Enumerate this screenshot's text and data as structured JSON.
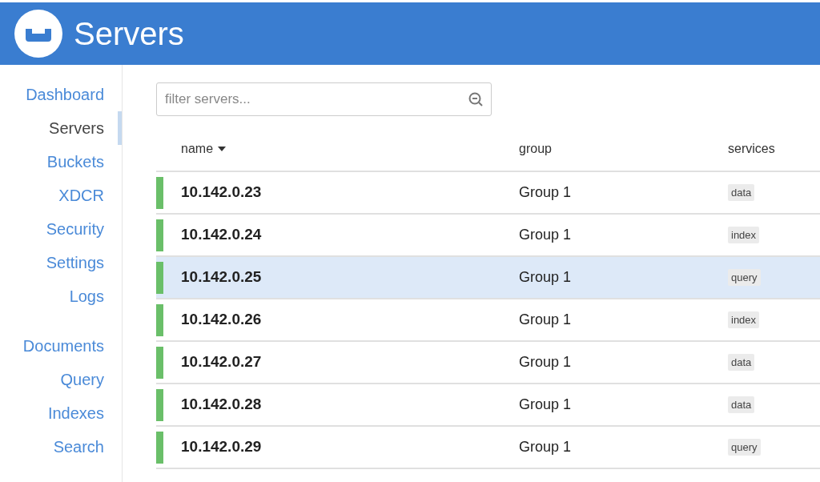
{
  "header": {
    "title": "Servers"
  },
  "sidebar": {
    "groups": [
      [
        {
          "label": "Dashboard",
          "selected": false
        },
        {
          "label": "Servers",
          "selected": true
        },
        {
          "label": "Buckets",
          "selected": false
        },
        {
          "label": "XDCR",
          "selected": false
        },
        {
          "label": "Security",
          "selected": false
        },
        {
          "label": "Settings",
          "selected": false
        },
        {
          "label": "Logs",
          "selected": false
        }
      ],
      [
        {
          "label": "Documents",
          "selected": false
        },
        {
          "label": "Query",
          "selected": false
        },
        {
          "label": "Indexes",
          "selected": false
        },
        {
          "label": "Search",
          "selected": false
        }
      ]
    ]
  },
  "filter": {
    "placeholder": "filter servers..."
  },
  "table": {
    "columns": [
      "name",
      "group",
      "services"
    ],
    "rows": [
      {
        "name": "10.142.0.23",
        "group": "Group 1",
        "service": "data",
        "selected": false
      },
      {
        "name": "10.142.0.24",
        "group": "Group 1",
        "service": "index",
        "selected": false
      },
      {
        "name": "10.142.0.25",
        "group": "Group 1",
        "service": "query",
        "selected": true
      },
      {
        "name": "10.142.0.26",
        "group": "Group 1",
        "service": "index",
        "selected": false
      },
      {
        "name": "10.142.0.27",
        "group": "Group 1",
        "service": "data",
        "selected": false
      },
      {
        "name": "10.142.0.28",
        "group": "Group 1",
        "service": "data",
        "selected": false
      },
      {
        "name": "10.142.0.29",
        "group": "Group 1",
        "service": "query",
        "selected": false
      }
    ]
  }
}
